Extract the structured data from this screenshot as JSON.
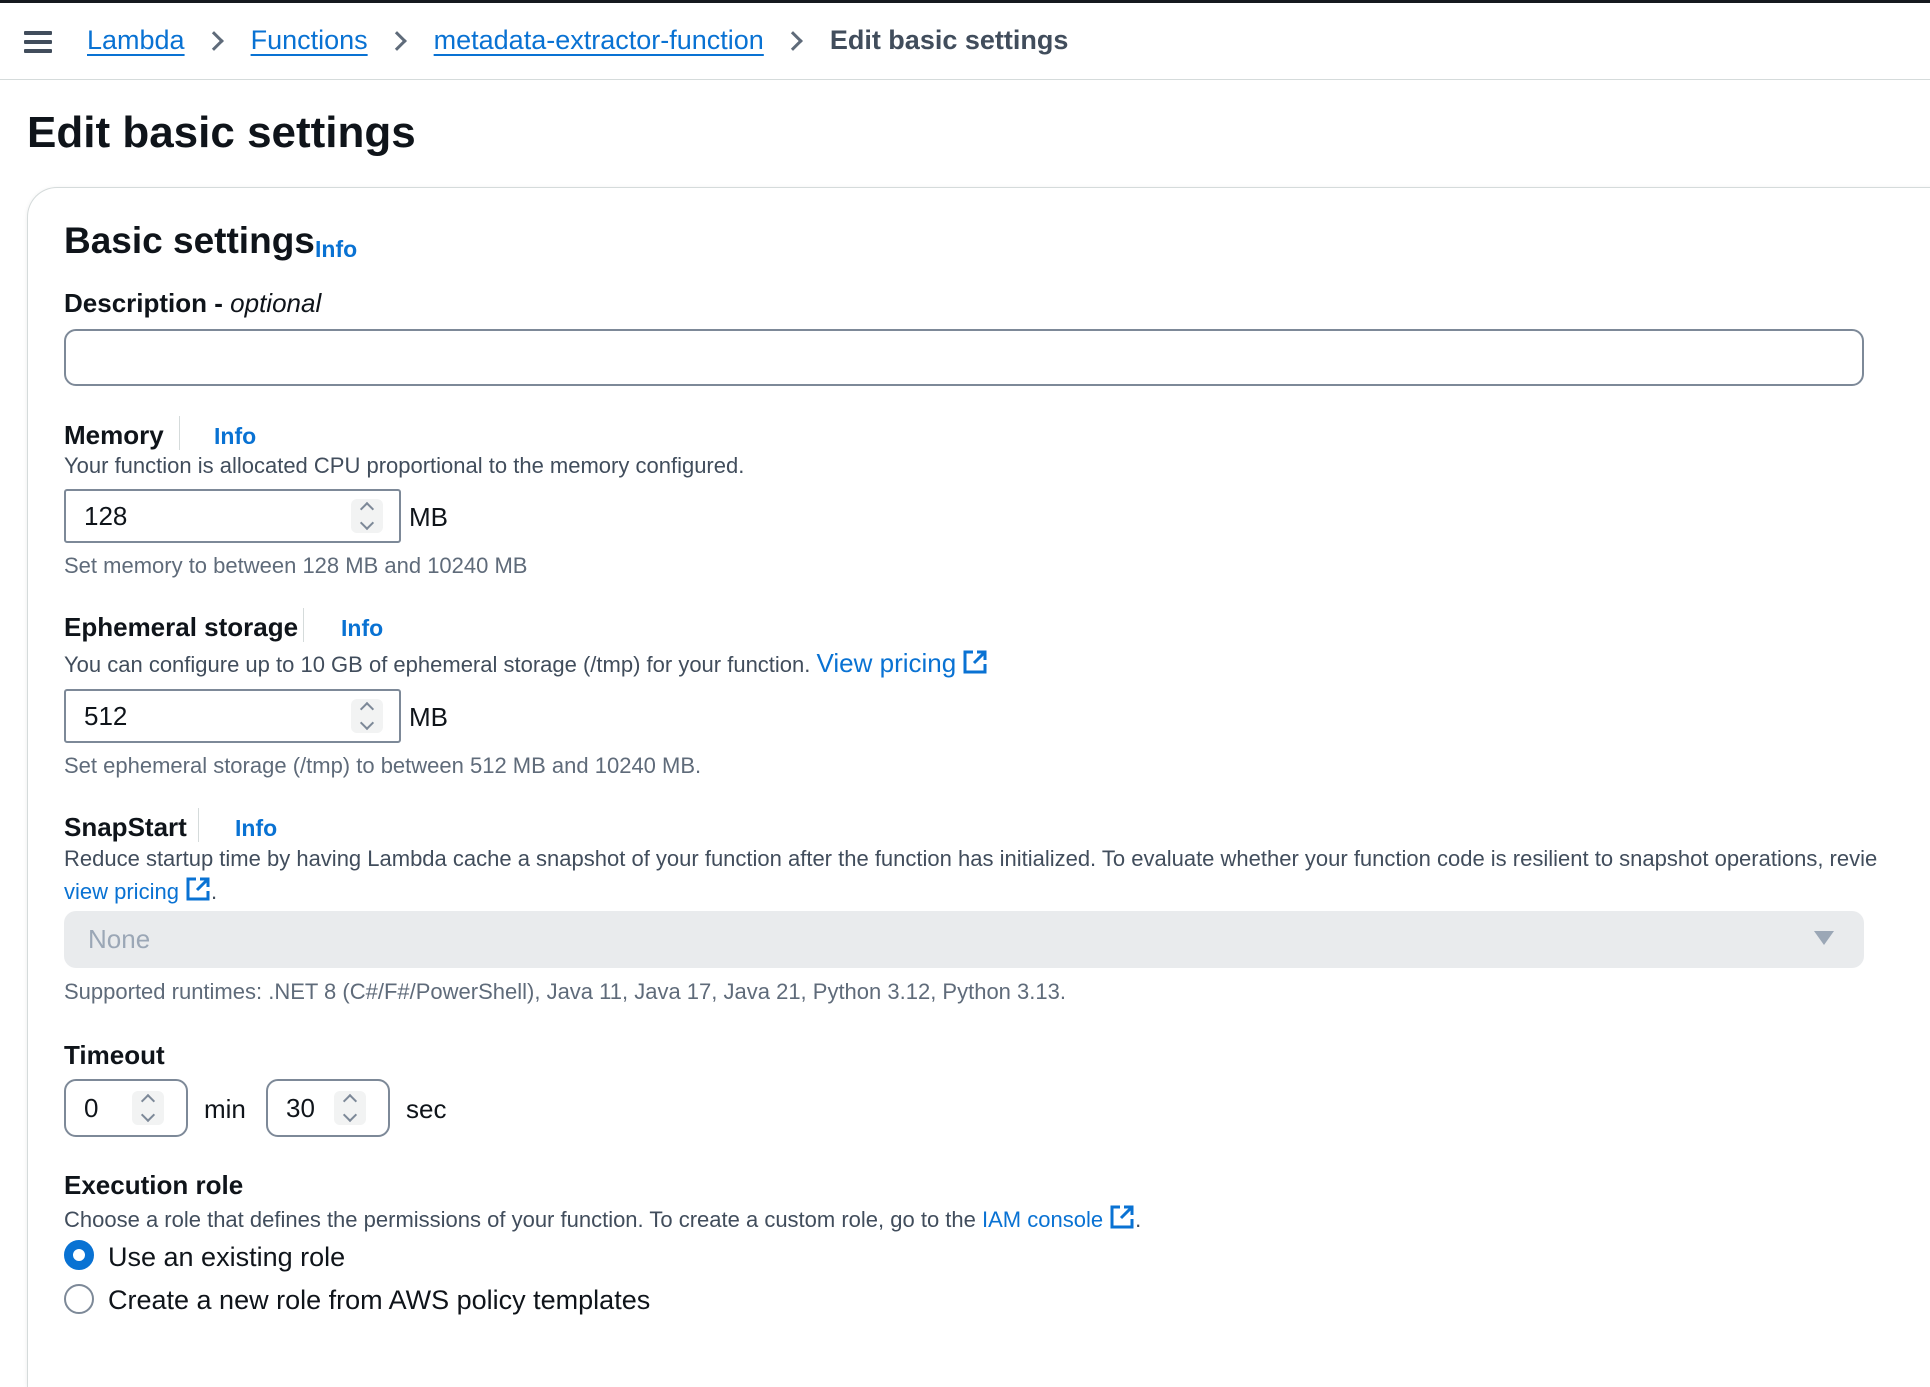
{
  "breadcrumb": {
    "items": [
      "Lambda",
      "Functions",
      "metadata-extractor-function"
    ],
    "current": "Edit basic settings"
  },
  "page_title": "Edit basic settings",
  "basic_settings": {
    "title": "Basic settings",
    "info": "Info"
  },
  "description": {
    "label": "Description -",
    "optional": "optional",
    "value": ""
  },
  "memory": {
    "label": "Memory",
    "info": "Info",
    "desc": "Your function is allocated CPU proportional to the memory configured.",
    "value": "128",
    "unit": "MB",
    "hint": "Set memory to between 128 MB and 10240 MB"
  },
  "ephemeral": {
    "label": "Ephemeral storage",
    "info": "Info",
    "desc": "You can configure up to 10 GB of ephemeral storage (/tmp) for your function.",
    "link": "View pricing",
    "value": "512",
    "unit": "MB",
    "hint": "Set ephemeral storage (/tmp) to between 512 MB and 10240 MB."
  },
  "snapstart": {
    "label": "SnapStart",
    "info": "Info",
    "desc": "Reduce startup time by having Lambda cache a snapshot of your function after the function has initialized. To evaluate whether your function code is resilient to snapshot operations, revie",
    "link": "view pricing",
    "select_value": "None",
    "hint": "Supported runtimes: .NET 8 (C#/F#/PowerShell), Java 11, Java 17, Java 21, Python 3.12, Python 3.13."
  },
  "timeout": {
    "label": "Timeout",
    "min_value": "0",
    "min_unit": "min",
    "sec_value": "30",
    "sec_unit": "sec"
  },
  "execution_role": {
    "label": "Execution role",
    "desc": "Choose a role that defines the permissions of your function. To create a custom role, go to the",
    "link": "IAM console",
    "options": [
      "Use an existing role",
      "Create a new role from AWS policy templates"
    ],
    "selected": 0
  },
  "colors": {
    "link": "#0972d3",
    "text": "#0f141a",
    "muted": "#414d5c",
    "border": "#7d8998"
  }
}
